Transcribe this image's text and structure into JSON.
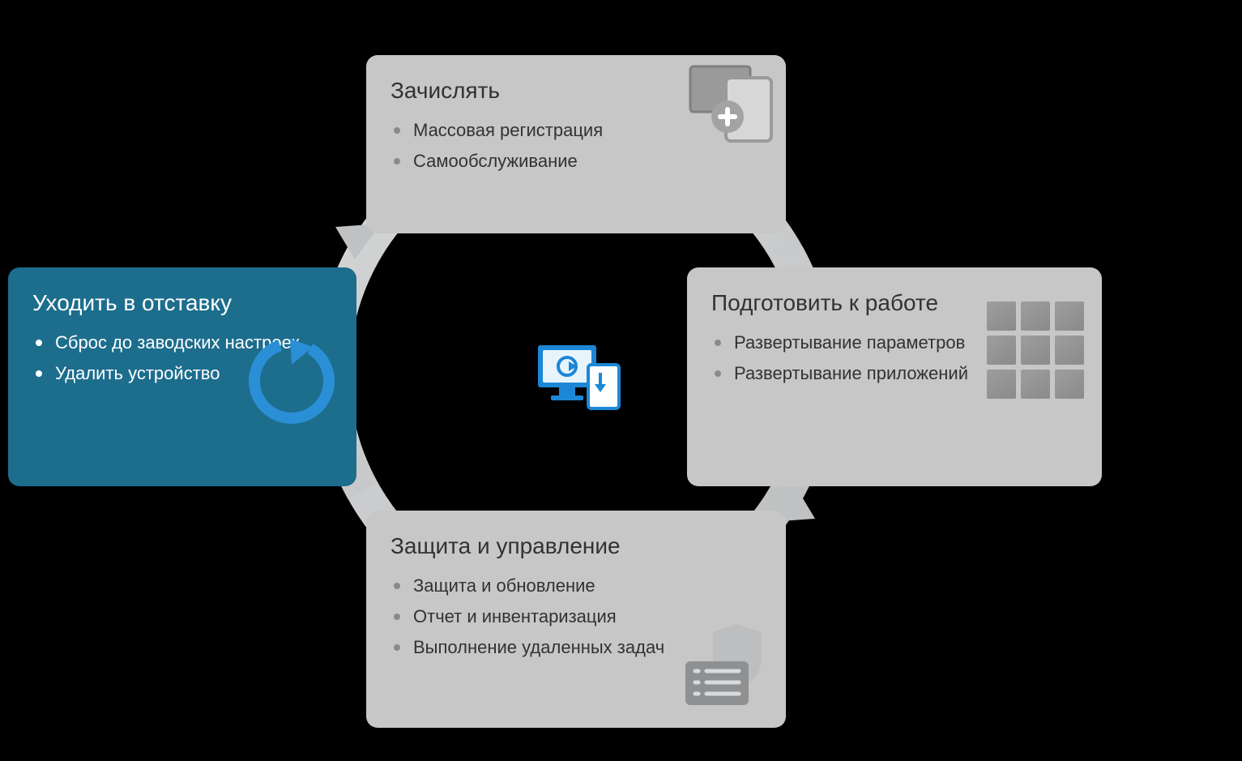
{
  "cards": {
    "enroll": {
      "title": "Зачислять",
      "items": [
        "Массовая регистрация",
        "Самообслуживание"
      ]
    },
    "provision": {
      "title": "Подготовить к работе",
      "items": [
        "Развертывание параметров",
        "Развертывание приложений"
      ]
    },
    "protect": {
      "title": "Защита и управление",
      "items": [
        "Защита и обновление",
        "Отчет и инвентаризация",
        "Выполнение удаленных задач"
      ]
    },
    "retire": {
      "title": "Уходить в отставку",
      "items": [
        "Сброс до заводских настроек",
        "Удалить устройство"
      ]
    }
  },
  "colors": {
    "cardGray": "#c7c7c8",
    "cardBlue": "#1d6d8d",
    "accent": "#1c87d6"
  }
}
